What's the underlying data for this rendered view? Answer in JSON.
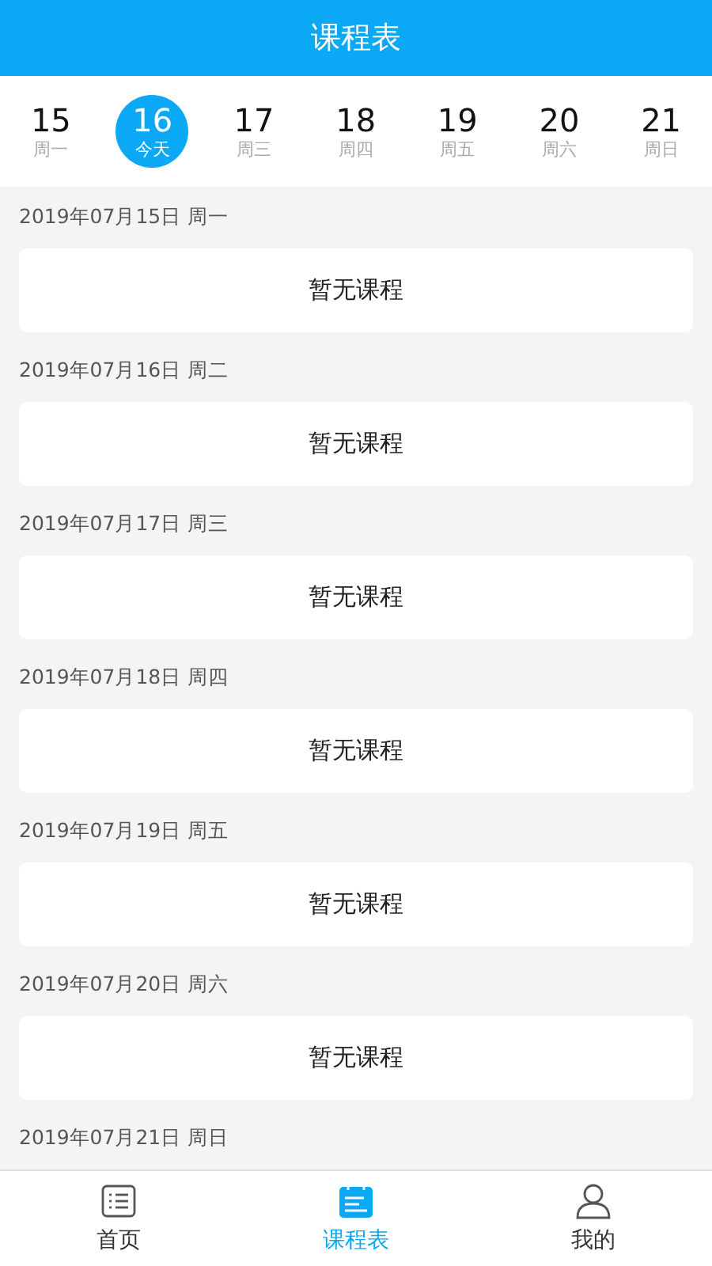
{
  "header": {
    "title": "课程表"
  },
  "days": [
    {
      "number": "15",
      "weekday": "周一",
      "selected": false
    },
    {
      "number": "16",
      "weekday": "今天",
      "selected": true
    },
    {
      "number": "17",
      "weekday": "周三",
      "selected": false
    },
    {
      "number": "18",
      "weekday": "周四",
      "selected": false
    },
    {
      "number": "19",
      "weekday": "周五",
      "selected": false
    },
    {
      "number": "20",
      "weekday": "周六",
      "selected": false
    },
    {
      "number": "21",
      "weekday": "周日",
      "selected": false
    }
  ],
  "schedule": [
    {
      "date": "2019年07月15日 周一",
      "message": "暂无课程"
    },
    {
      "date": "2019年07月16日 周二",
      "message": "暂无课程"
    },
    {
      "date": "2019年07月17日 周三",
      "message": "暂无课程"
    },
    {
      "date": "2019年07月18日 周四",
      "message": "暂无课程"
    },
    {
      "date": "2019年07月19日 周五",
      "message": "暂无课程"
    },
    {
      "date": "2019年07月20日 周六",
      "message": "暂无课程"
    },
    {
      "date": "2019年07月21日 周日"
    }
  ],
  "nav": [
    {
      "kind": "list",
      "label": "首页",
      "selected": false
    },
    {
      "kind": "calendar",
      "label": "课程表",
      "selected": true
    },
    {
      "kind": "person",
      "label": "我的",
      "selected": false
    }
  ]
}
